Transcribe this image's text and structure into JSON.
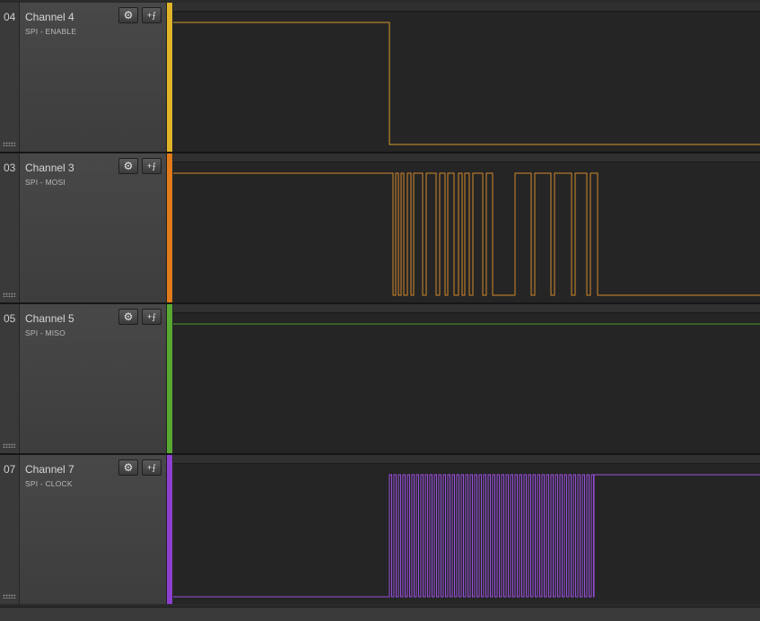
{
  "channels": [
    {
      "num": "04",
      "name": "Channel 4",
      "sub": "SPI - ENABLE",
      "color": "#e0b428",
      "wave": "#d49a2a"
    },
    {
      "num": "03",
      "name": "Channel 3",
      "sub": "SPI - MOSI",
      "color": "#e07a1a",
      "wave": "#d4892a"
    },
    {
      "num": "05",
      "name": "Channel 5",
      "sub": "SPI - MISO",
      "color": "#58a832",
      "wave": "#4f9a2a"
    },
    {
      "num": "07",
      "name": "Channel 7",
      "sub": "SPI - CLOCK",
      "color": "#8d3fd0",
      "wave": "#9a4fe0"
    }
  ],
  "icons": {
    "settings": "gear-icon",
    "trigger": "trigger-add-icon"
  }
}
